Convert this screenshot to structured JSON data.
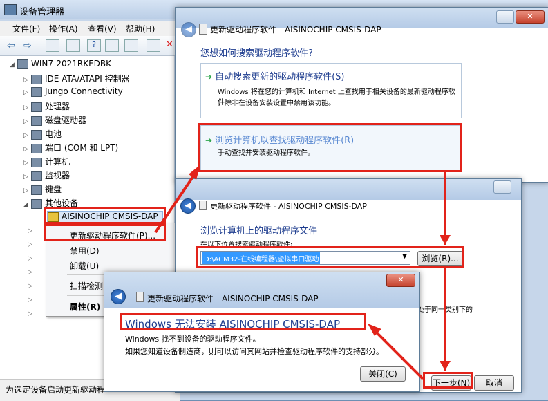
{
  "devmgr": {
    "title": "设备管理器",
    "menus": [
      "文件(F)",
      "操作(A)",
      "查看(V)",
      "帮助(H)"
    ],
    "tree_root": "WIN7-2021RKEDBK",
    "tree_items": [
      "IDE ATA/ATAPI 控制器",
      "Jungo Connectivity",
      "处理器",
      "磁盘驱动器",
      "电池",
      "端口 (COM 和 LPT)",
      "计算机",
      "监视器",
      "键盘",
      "其他设备"
    ],
    "selected_device": "AISINOCHIP CMSIS-DAP",
    "status": "为选定设备启动更新驱动程"
  },
  "context_menu": {
    "items": [
      "更新驱动程序软件(P)...",
      "禁用(D)",
      "卸载(U)",
      "扫描检测",
      "属性(R)"
    ]
  },
  "dialog1": {
    "title": "更新驱动程序软件 - AISINOCHIP CMSIS-DAP",
    "question": "您想如何搜索驱动程序软件?",
    "opt1_title": "自动搜索更新的驱动程序软件(S)",
    "opt1_desc1": "Windows 将在您的计算机和 Internet 上查找用于相关设备的最新驱动程序软件",
    "opt1_desc2": "，除非在设备安装设置中禁用该功能。",
    "opt2_title": "浏览计算机以查找驱动程序软件(R)",
    "opt2_desc": "手动查找并安装驱动程序软件。"
  },
  "dialog2": {
    "title": "更新驱动程序软件 - AISINOCHIP CMSIS-DAP",
    "heading": "浏览计算机上的驱动程序文件",
    "path_label": "在以下位置搜索驱动程序软件:",
    "path_value": "D:\\ACM32-在线编程器\\虚拟串口驱动",
    "browse_button": "浏览(R)...",
    "partial_text": "处于同一类别下的",
    "next_button": "下一步(N)",
    "cancel_button": "取消"
  },
  "dialog3": {
    "title": "更新驱动程序软件 - AISINOCHIP CMSIS-DAP",
    "error_heading": "Windows 无法安装 AISINOCHIP CMSIS-DAP",
    "line1": "Windows 找不到设备的驱动程序文件。",
    "line2": "如果您知道设备制造商，则可以访问其网站并检查驱动程序软件的支持部分。",
    "close_button": "关闭(C)"
  }
}
